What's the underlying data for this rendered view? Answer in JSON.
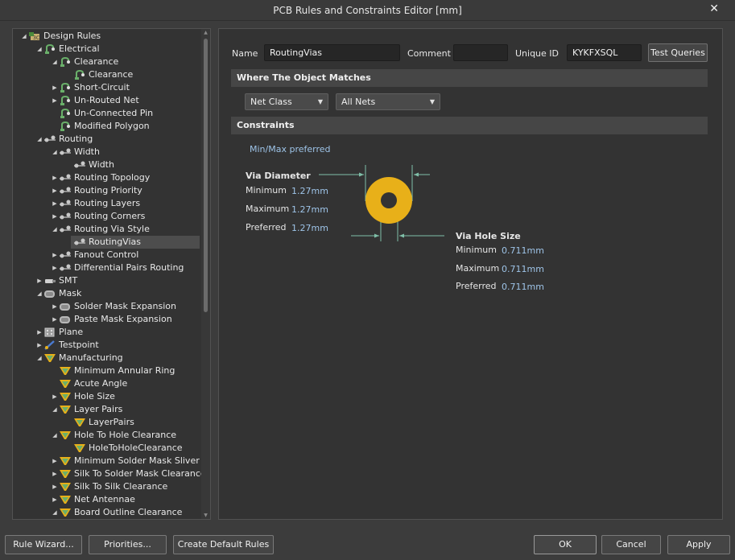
{
  "window": {
    "title": "PCB Rules and Constraints Editor [mm]"
  },
  "tree": [
    {
      "label": "Design Rules",
      "level": 0,
      "expanded": true,
      "icon": "design-rules-icon"
    },
    {
      "label": "Electrical",
      "level": 1,
      "expanded": true,
      "icon": "electrical-icon"
    },
    {
      "label": "Clearance",
      "level": 2,
      "expanded": true,
      "icon": "electrical-icon"
    },
    {
      "label": "Clearance",
      "level": 3,
      "expanded": null,
      "icon": "electrical-icon"
    },
    {
      "label": "Short-Circuit",
      "level": 2,
      "expanded": false,
      "icon": "electrical-icon"
    },
    {
      "label": "Un-Routed Net",
      "level": 2,
      "expanded": false,
      "icon": "electrical-icon"
    },
    {
      "label": "Un-Connected Pin",
      "level": 2,
      "expanded": null,
      "icon": "electrical-icon"
    },
    {
      "label": "Modified Polygon",
      "level": 2,
      "expanded": null,
      "icon": "electrical-icon"
    },
    {
      "label": "Routing",
      "level": 1,
      "expanded": true,
      "icon": "routing-icon"
    },
    {
      "label": "Width",
      "level": 2,
      "expanded": true,
      "icon": "routing-icon"
    },
    {
      "label": "Width",
      "level": 3,
      "expanded": null,
      "icon": "routing-icon"
    },
    {
      "label": "Routing Topology",
      "level": 2,
      "expanded": false,
      "icon": "routing-icon"
    },
    {
      "label": "Routing Priority",
      "level": 2,
      "expanded": false,
      "icon": "routing-icon"
    },
    {
      "label": "Routing Layers",
      "level": 2,
      "expanded": false,
      "icon": "routing-icon"
    },
    {
      "label": "Routing Corners",
      "level": 2,
      "expanded": false,
      "icon": "routing-icon"
    },
    {
      "label": "Routing Via Style",
      "level": 2,
      "expanded": true,
      "icon": "routing-icon"
    },
    {
      "label": "RoutingVias",
      "level": 3,
      "expanded": null,
      "icon": "routing-icon",
      "selected": true
    },
    {
      "label": "Fanout Control",
      "level": 2,
      "expanded": false,
      "icon": "routing-icon"
    },
    {
      "label": "Differential Pairs Routing",
      "level": 2,
      "expanded": false,
      "icon": "routing-icon"
    },
    {
      "label": "SMT",
      "level": 1,
      "expanded": false,
      "icon": "smt-icon"
    },
    {
      "label": "Mask",
      "level": 1,
      "expanded": true,
      "icon": "mask-icon"
    },
    {
      "label": "Solder Mask Expansion",
      "level": 2,
      "expanded": false,
      "icon": "mask-icon"
    },
    {
      "label": "Paste Mask Expansion",
      "level": 2,
      "expanded": false,
      "icon": "mask-icon"
    },
    {
      "label": "Plane",
      "level": 1,
      "expanded": false,
      "icon": "plane-icon"
    },
    {
      "label": "Testpoint",
      "level": 1,
      "expanded": false,
      "icon": "testpoint-icon"
    },
    {
      "label": "Manufacturing",
      "level": 1,
      "expanded": true,
      "icon": "manufacturing-icon"
    },
    {
      "label": "Minimum Annular Ring",
      "level": 2,
      "expanded": null,
      "icon": "manufacturing-icon"
    },
    {
      "label": "Acute Angle",
      "level": 2,
      "expanded": null,
      "icon": "manufacturing-icon"
    },
    {
      "label": "Hole Size",
      "level": 2,
      "expanded": false,
      "icon": "manufacturing-icon"
    },
    {
      "label": "Layer Pairs",
      "level": 2,
      "expanded": true,
      "icon": "manufacturing-icon"
    },
    {
      "label": "LayerPairs",
      "level": 3,
      "expanded": null,
      "icon": "manufacturing-icon"
    },
    {
      "label": "Hole To Hole Clearance",
      "level": 2,
      "expanded": true,
      "icon": "manufacturing-icon"
    },
    {
      "label": "HoleToHoleClearance",
      "level": 3,
      "expanded": null,
      "icon": "manufacturing-icon"
    },
    {
      "label": "Minimum Solder Mask Sliver",
      "level": 2,
      "expanded": false,
      "icon": "manufacturing-icon"
    },
    {
      "label": "Silk To Solder Mask Clearance",
      "level": 2,
      "expanded": false,
      "icon": "manufacturing-icon"
    },
    {
      "label": "Silk To Silk Clearance",
      "level": 2,
      "expanded": false,
      "icon": "manufacturing-icon"
    },
    {
      "label": "Net Antennae",
      "level": 2,
      "expanded": false,
      "icon": "manufacturing-icon"
    },
    {
      "label": "Board Outline Clearance",
      "level": 2,
      "expanded": true,
      "icon": "manufacturing-icon"
    }
  ],
  "rule": {
    "name_label": "Name",
    "name_value": "RoutingVias",
    "comment_label": "Comment",
    "comment_value": "",
    "uid_label": "Unique ID",
    "uid_value": "KYKFXSQL",
    "test_queries": "Test Queries"
  },
  "where": {
    "title": "Where The Object Matches",
    "scope": "Net Class",
    "target": "All Nets"
  },
  "constraints": {
    "title": "Constraints",
    "mode": "Min/Max preferred",
    "via_diameter": {
      "title": "Via Diameter",
      "min_label": "Minimum",
      "min": "1.27mm",
      "max_label": "Maximum",
      "max": "1.27mm",
      "pref_label": "Preferred",
      "pref": "1.27mm"
    },
    "hole_size": {
      "title": "Via Hole Size",
      "min_label": "Minimum",
      "min": "0.711mm",
      "max_label": "Maximum",
      "max": "0.711mm",
      "pref_label": "Preferred",
      "pref": "0.711mm"
    }
  },
  "buttons": {
    "rule_wizard": "Rule Wizard...",
    "priorities": "Priorities...",
    "create_default": "Create Default Rules",
    "ok": "OK",
    "cancel": "Cancel",
    "apply": "Apply"
  },
  "colors": {
    "via_ring": "#e8b019",
    "accent_value": "#9ec4e8"
  }
}
